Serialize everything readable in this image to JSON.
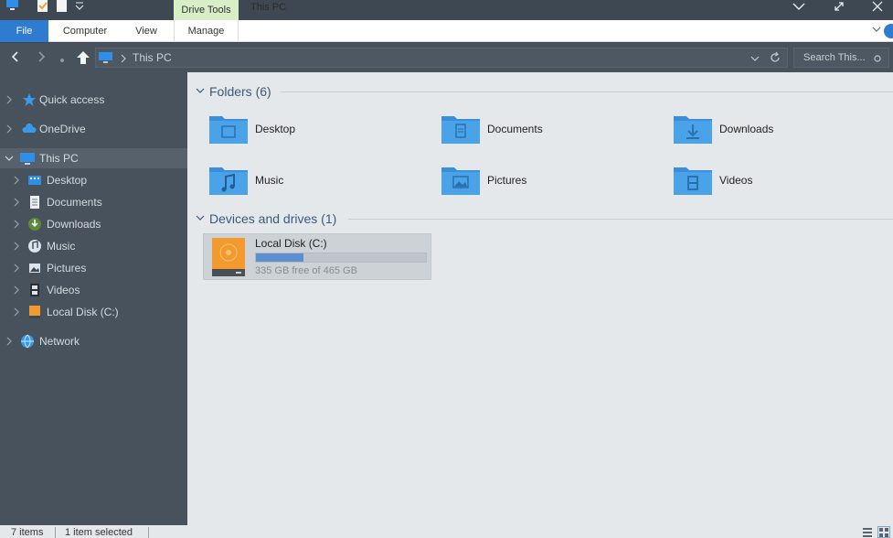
{
  "window": {
    "title": "This PC",
    "contextual_tab": "Drive Tools"
  },
  "ribbon": {
    "tabs": [
      {
        "label": "File"
      },
      {
        "label": "Computer"
      },
      {
        "label": "View"
      },
      {
        "label": "Manage"
      }
    ]
  },
  "address": {
    "path": "This PC",
    "search_placeholder": "Search This..."
  },
  "nav": {
    "items": [
      {
        "label": "Quick access",
        "icon": "star-icon"
      },
      {
        "label": "OneDrive",
        "icon": "cloud-icon"
      },
      {
        "label": "This PC",
        "icon": "computer-icon"
      },
      {
        "label": "Desktop",
        "icon": "desktop-icon"
      },
      {
        "label": "Documents",
        "icon": "documents-icon"
      },
      {
        "label": "Downloads",
        "icon": "downloads-icon"
      },
      {
        "label": "Music",
        "icon": "music-icon"
      },
      {
        "label": "Pictures",
        "icon": "pictures-icon"
      },
      {
        "label": "Videos",
        "icon": "videos-icon"
      },
      {
        "label": "Local Disk (C:)",
        "icon": "drive-icon"
      },
      {
        "label": "Network",
        "icon": "network-icon"
      }
    ]
  },
  "folders": {
    "header": "Folders (6)",
    "items": [
      {
        "label": "Desktop",
        "icon": "desktop-folder-icon"
      },
      {
        "label": "Documents",
        "icon": "documents-folder-icon"
      },
      {
        "label": "Downloads",
        "icon": "downloads-folder-icon"
      },
      {
        "label": "Music",
        "icon": "music-folder-icon"
      },
      {
        "label": "Pictures",
        "icon": "pictures-folder-icon"
      },
      {
        "label": "Videos",
        "icon": "videos-folder-icon"
      }
    ]
  },
  "devices": {
    "header": "Devices and drives (1)",
    "drive": {
      "name": "Local Disk (C:)",
      "free_text": "335 GB free of 465 GB",
      "used_fraction": 0.28
    }
  },
  "status": {
    "items_count": "7 items",
    "selection": "1 item selected"
  },
  "colors": {
    "accent": "#2f7bd0",
    "drive_tools_tab": "#d8eec6",
    "folder_blue": "#4aa3e8"
  }
}
